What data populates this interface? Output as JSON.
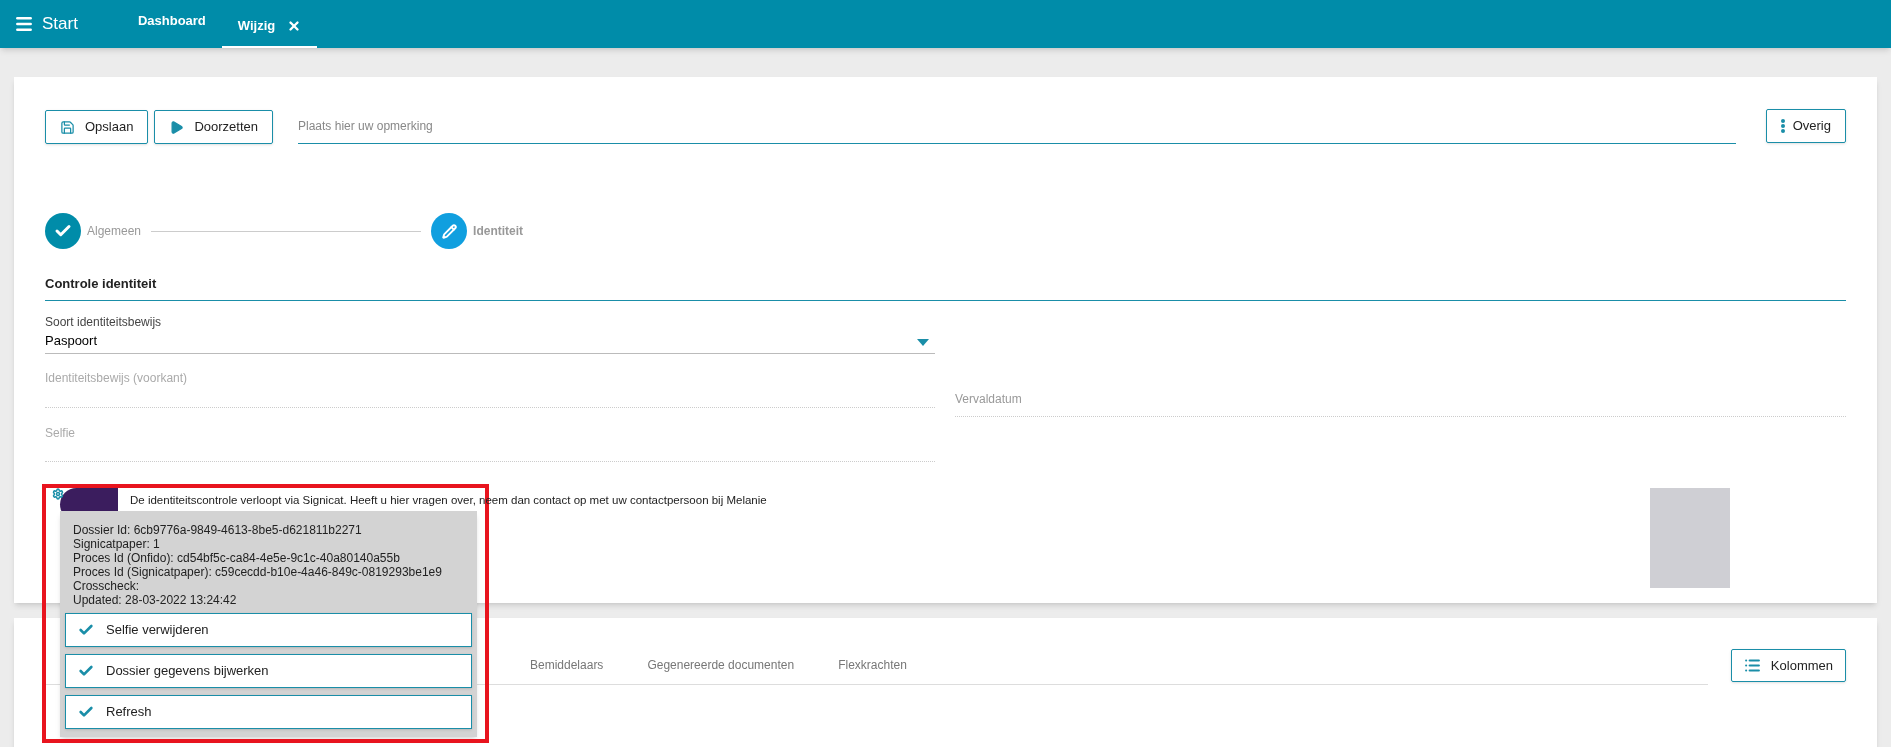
{
  "topbar": {
    "title": "Start",
    "tabs": [
      {
        "label": "Dashboard",
        "selected": false,
        "closable": false
      },
      {
        "label": "Wijzig",
        "selected": true,
        "closable": true
      }
    ]
  },
  "toolbar": {
    "buttons": [
      {
        "label": "Opslaan",
        "kind": "save"
      },
      {
        "label": "Doorzetten",
        "kind": "play"
      }
    ],
    "remark": {
      "placeholder": "Plaats hier uw opmerking"
    },
    "more": {
      "label": "Overig"
    }
  },
  "steps": [
    {
      "label": "Algemeen",
      "done": true,
      "selected": false
    },
    {
      "label": "Identiteit",
      "done": false,
      "selected": true
    }
  ],
  "section": {
    "title": "Controle identiteit"
  },
  "fields": {
    "id_type": {
      "label": "Soort identiteitsbewijs",
      "value": "Paspoort"
    },
    "front": {
      "label": "Identiteitsbewijs (voorkant)"
    },
    "expiry": {
      "label": "Vervaldatum"
    },
    "selfie": {
      "label": "Selfie"
    }
  },
  "signicat": {
    "notice": "De identiteitscontrole verloopt via Signicat. Heeft u hier vragen over, neem dan contact op met uw contactpersoon bij Melanie"
  },
  "popup": {
    "lines": [
      "Dossier Id: 6cb9776a-9849-4613-8be5-d621811b2271",
      "Signicatpaper: 1",
      "Proces Id (Onfido): cd54bf5c-ca84-4e5e-9c1c-40a80140a55b",
      "Proces Id (Signicatpaper): c59cecdd-b10e-4a46-849c-0819293be1e9",
      "Crosscheck:",
      "Updated: 28-03-2022 13:24:42"
    ],
    "actions": [
      "Selfie verwijderen",
      "Dossier gegevens bijwerken",
      "Refresh"
    ]
  },
  "lower": {
    "tabs": [
      {
        "label": "Bemiddelaars",
        "selected": false
      },
      {
        "label": "Gegenereerde documenten",
        "selected": false
      },
      {
        "label": "Flexkrachten",
        "selected": false
      }
    ],
    "columns_button": "Kolommen"
  }
}
